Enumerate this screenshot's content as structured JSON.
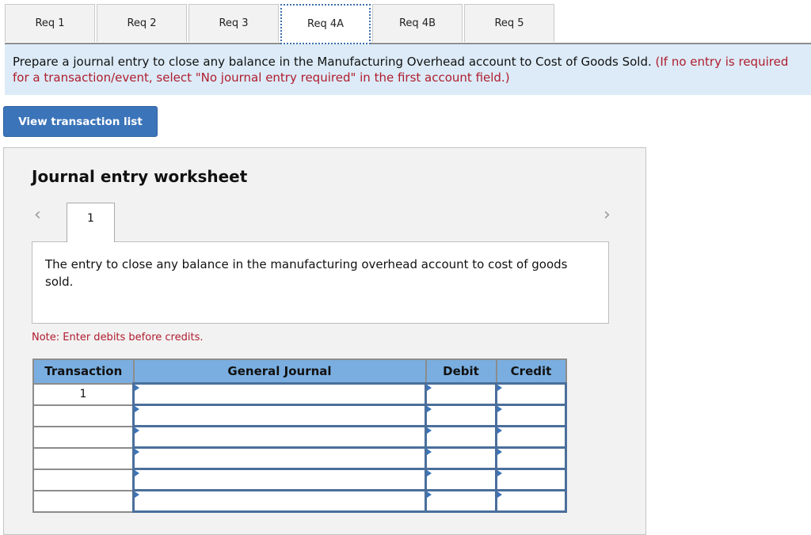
{
  "tabs": [
    {
      "label": "Req 1",
      "active": false
    },
    {
      "label": "Req 2",
      "active": false
    },
    {
      "label": "Req 3",
      "active": false
    },
    {
      "label": "Req 4A",
      "active": true
    },
    {
      "label": "Req 4B",
      "active": false
    },
    {
      "label": "Req 5",
      "active": false
    }
  ],
  "instructions": {
    "main": "Prepare a journal entry to close any balance in the Manufacturing Overhead account to Cost of Goods Sold.",
    "note": "(If no entry is required for a transaction/event, select \"No journal entry required\" in the first account field.)"
  },
  "view_transaction_button": "View transaction list",
  "worksheet": {
    "title": "Journal entry worksheet",
    "prev_icon": "chevron-left-icon",
    "next_icon": "chevron-right-icon",
    "entry_tab": "1",
    "description": "The entry to close any balance in the manufacturing overhead account to cost of goods sold.",
    "note": "Note: Enter debits before credits.",
    "table": {
      "headers": [
        "Transaction",
        "General Journal",
        "Debit",
        "Credit"
      ],
      "rows": [
        {
          "transaction": "1",
          "account": "",
          "debit": "",
          "credit": ""
        },
        {
          "transaction": "",
          "account": "",
          "debit": "",
          "credit": ""
        },
        {
          "transaction": "",
          "account": "",
          "debit": "",
          "credit": ""
        },
        {
          "transaction": "",
          "account": "",
          "debit": "",
          "credit": ""
        },
        {
          "transaction": "",
          "account": "",
          "debit": "",
          "credit": ""
        },
        {
          "transaction": "",
          "account": "",
          "debit": "",
          "credit": ""
        }
      ]
    }
  }
}
